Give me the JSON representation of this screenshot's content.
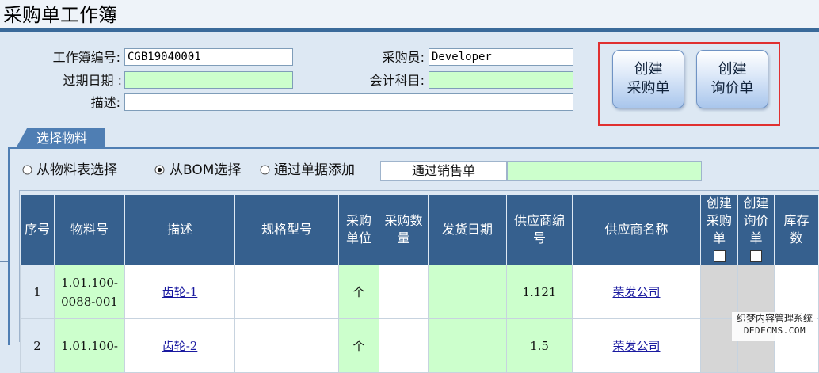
{
  "page": {
    "title": "采购单工作簿"
  },
  "form": {
    "workbook_no_label": "工作簿编号:",
    "workbook_no_value": "CGB19040001",
    "buyer_label": "采购员:",
    "buyer_value": "Developer",
    "expiry_label": "过期日期 :",
    "expiry_value": "",
    "account_label": "会计科目:",
    "account_value": "",
    "desc_label": "描述:",
    "desc_value": ""
  },
  "actions": {
    "create_po": [
      "创建",
      "采购单"
    ],
    "create_rfq": [
      "创建",
      "询价单"
    ]
  },
  "tab": {
    "label": "选择物料"
  },
  "source": {
    "options": [
      {
        "label": "从物料表选择",
        "selected": false
      },
      {
        "label": "从BOM选择",
        "selected": true
      },
      {
        "label": "通过单据添加",
        "selected": false
      }
    ],
    "doc_type": "通过销售单",
    "doc_no": ""
  },
  "grid": {
    "headers": {
      "seq": "序号",
      "material_no": "物料号",
      "desc": "描述",
      "spec": "规格型号",
      "unit": [
        "采购",
        "单位"
      ],
      "qty": [
        "采购数",
        "量"
      ],
      "ship_date": "发货日期",
      "vendor_no": [
        "供应商编",
        "号"
      ],
      "vendor_name": "供应商名称",
      "create_po": [
        "创建",
        "采购",
        "单"
      ],
      "create_rfq": [
        "创建",
        "询价",
        "单"
      ],
      "stock": [
        "库存",
        "数"
      ]
    },
    "rows": [
      {
        "seq": "1",
        "material_no": [
          "1.01.100-",
          "0088-001"
        ],
        "desc": "齿轮-1",
        "spec": "",
        "unit": "个",
        "qty": "",
        "ship_date": "",
        "vendor_no": "1.121",
        "vendor_name": "荣发公司",
        "stock": ""
      },
      {
        "seq": "2",
        "material_no": [
          "1.01.100-",
          ""
        ],
        "desc": "齿轮-2",
        "spec": "",
        "unit": "个",
        "qty": "",
        "ship_date": "",
        "vendor_no": "1.5",
        "vendor_name": "荣发公司",
        "stock": ""
      }
    ]
  },
  "watermark": {
    "line1": "织梦内容管理系统",
    "line2": "DEDECMS.COM"
  },
  "colors": {
    "header_bg": "#36608e",
    "green_cell": "#ccffcc",
    "accent_red": "#e03030"
  }
}
